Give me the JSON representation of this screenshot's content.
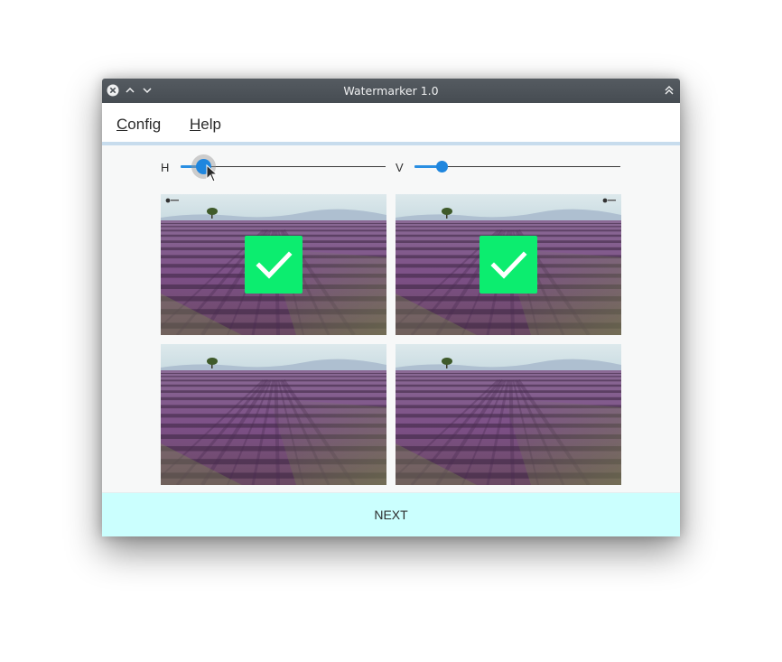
{
  "window": {
    "title": "Watermarker 1.0"
  },
  "menu": {
    "config": {
      "mnemonic": "C",
      "rest": "onfig"
    },
    "help": {
      "mnemonic": "H",
      "rest": "elp"
    }
  },
  "sliders": {
    "horizontal": {
      "label": "H",
      "value": 0.11
    },
    "vertical": {
      "label": "V",
      "value": 0.13
    }
  },
  "tiles": [
    {
      "selected": true,
      "logo_position": "top-left"
    },
    {
      "selected": true,
      "logo_position": "top-right"
    },
    {
      "selected": false,
      "logo_position": "none"
    },
    {
      "selected": false,
      "logo_position": "none"
    }
  ],
  "colors": {
    "accent": "#1f86de",
    "check": "#0ced6f",
    "next_bg": "#cbfffe"
  },
  "next_button": {
    "label": "NEXT"
  }
}
